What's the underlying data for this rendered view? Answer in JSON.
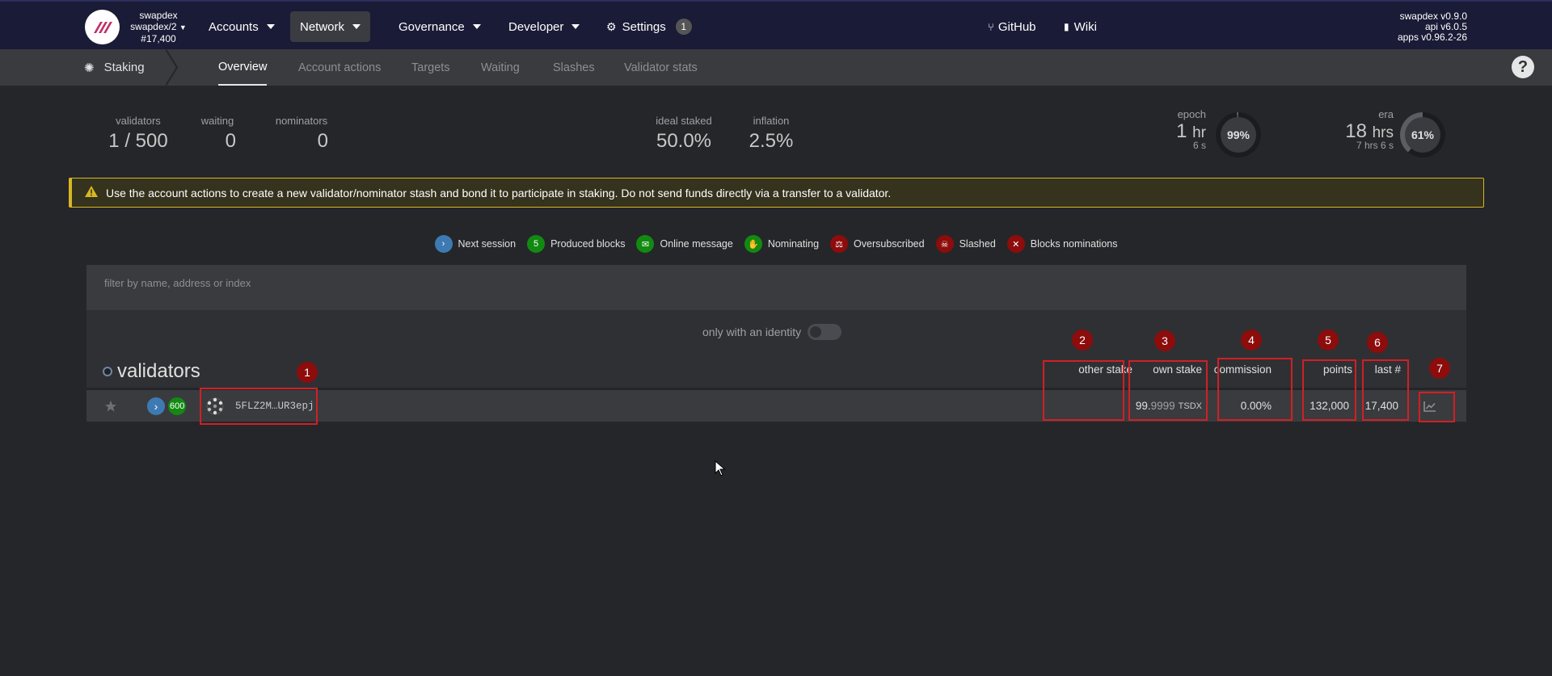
{
  "topnav": {
    "chain_name": "swapdex",
    "chain_spec": "swapdex/2",
    "block": "#17,400",
    "items": [
      {
        "label": "Accounts"
      },
      {
        "label": "Network"
      },
      {
        "label": "Governance"
      },
      {
        "label": "Developer"
      },
      {
        "label": "Settings",
        "badge": "1"
      }
    ],
    "links": [
      {
        "label": "GitHub"
      },
      {
        "label": "Wiki"
      }
    ],
    "version": [
      "swapdex v0.9.0",
      "api v6.0.5",
      "apps v0.96.2-26"
    ]
  },
  "subnav": {
    "section": "Staking",
    "tabs": [
      "Overview",
      "Account actions",
      "Targets",
      "Waiting",
      "Slashes",
      "Validator stats"
    ],
    "help": "?"
  },
  "summary": {
    "validators_label": "validators",
    "validators_value": "1 / 500",
    "waiting_label": "waiting",
    "waiting_value": "0",
    "nominators_label": "nominators",
    "nominators_value": "0",
    "ideal_label": "ideal staked",
    "ideal_value": "50.0%",
    "inflation_label": "inflation",
    "inflation_value": "2.5%",
    "epoch_label": "epoch",
    "epoch_big": "1",
    "epoch_unit": "hr",
    "epoch_sub": "6 s",
    "epoch_percent": "99%",
    "epoch_progress": 0.99,
    "era_label": "era",
    "era_big": "18",
    "era_unit": "hrs",
    "era_sub": "7 hrs 6 s",
    "era_percent": "61%",
    "era_progress": 0.61
  },
  "warning": "Use the account actions to create a new validator/nominator stash and bond it to participate in staking. Do not send funds directly via a transfer to a validator.",
  "legend": [
    {
      "label": "Next session",
      "glyph": "›",
      "color": "#3d7ab3"
    },
    {
      "label": "Produced blocks",
      "glyph": "5",
      "color": "#128a12"
    },
    {
      "label": "Online message",
      "glyph": "✉",
      "color": "#128a12"
    },
    {
      "label": "Nominating",
      "glyph": "✋",
      "color": "#128a12"
    },
    {
      "label": "Oversubscribed",
      "glyph": "⚖",
      "color": "#8d0c0c"
    },
    {
      "label": "Slashed",
      "glyph": "☠",
      "color": "#8d0c0c"
    },
    {
      "label": "Blocks nominations",
      "glyph": "✕",
      "color": "#8d0c0c"
    }
  ],
  "filter": {
    "placeholder": "filter by name, address or index"
  },
  "toggle_label": "only with an identity",
  "table": {
    "title": "validators",
    "columns": {
      "other_stake": "other stake",
      "own_stake": "own stake",
      "commission": "commission",
      "points": "points",
      "last": "last #"
    },
    "rows": [
      {
        "blocks_badge": "600",
        "address": "5FLZ2M…UR3epj",
        "other_stake": "",
        "own_stake_int": "99.",
        "own_stake_dec": "9999",
        "own_stake_unit": "TSDX",
        "commission": "0.00%",
        "points": "132,000",
        "last": "17,400"
      }
    ]
  },
  "annotations": [
    "1",
    "2",
    "3",
    "4",
    "5",
    "6",
    "7"
  ]
}
